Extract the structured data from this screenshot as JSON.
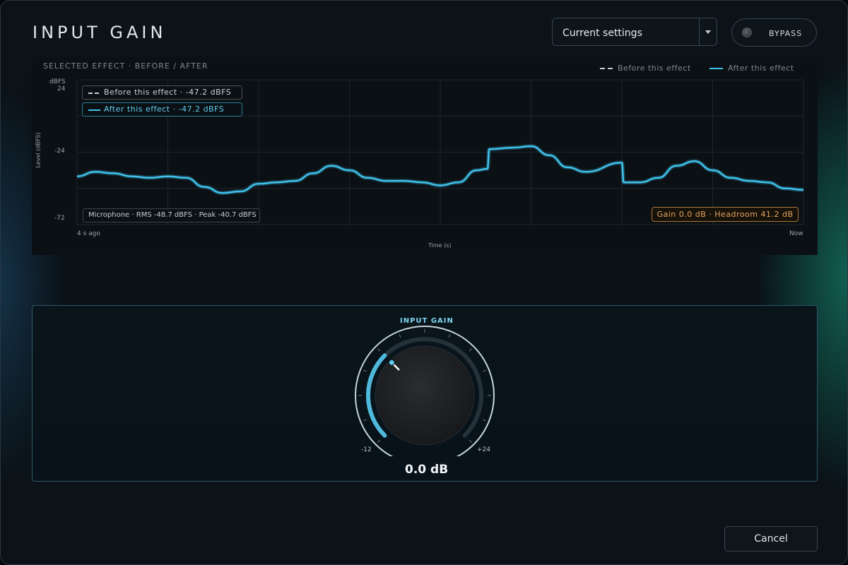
{
  "header": {
    "title": "INPUT GAIN"
  },
  "preset": {
    "selected": "Current settings"
  },
  "bypass": {
    "label": "BYPASS",
    "active": false
  },
  "colors": {
    "before": "#c8cfd4",
    "after": "#3fc3ec",
    "gain_accent": "#e6a65e"
  },
  "chart": {
    "heading": "SELECTED EFFECT · BEFORE / AFTER",
    "legend": {
      "before": "Before this effect",
      "after": "After this effect"
    },
    "callout_before": "Before this effect · -47.2 dBFS",
    "callout_after": "After this effect · -47.2 dBFS",
    "caption": "Microphone · RMS -48.7 dBFS · Peak -40.7 dBFS",
    "gain_readout": "Gain 0.0 dB · Headroom 41.2 dB",
    "unit_label": "dBFS",
    "y_title": "Level (dBFS)",
    "x_title": "Time (s)",
    "x_start_label": "4 s ago",
    "x_end_label": "Now",
    "y_ticks": [
      "24",
      "-24",
      "-72"
    ]
  },
  "chart_data": {
    "type": "line",
    "title": "",
    "xlabel": "Time (s)",
    "ylabel": "Level (dBFS)",
    "ylim": [
      -72,
      24
    ],
    "xlim": [
      -4,
      0
    ],
    "grid": true,
    "legend_position": "top-right",
    "series": [
      {
        "name": "After this effect",
        "x": [
          -4.0,
          -3.9,
          -3.8,
          -3.7,
          -3.6,
          -3.5,
          -3.4,
          -3.3,
          -3.2,
          -3.1,
          -3.0,
          -2.9,
          -2.8,
          -2.7,
          -2.6,
          -2.5,
          -2.4,
          -2.3,
          -2.2,
          -2.1,
          -2.0,
          -1.9,
          -1.8,
          -1.74,
          -1.73,
          -1.6,
          -1.5,
          -1.4,
          -1.3,
          -1.2,
          -1.0,
          -0.99,
          -0.9,
          -0.8,
          -0.7,
          -0.6,
          -0.5,
          -0.4,
          -0.3,
          -0.2,
          -0.1,
          0.0
        ],
        "y": [
          -40,
          -37,
          -38,
          -40,
          -41,
          -40,
          -41,
          -47,
          -51,
          -50,
          -45,
          -44,
          -43,
          -38,
          -33,
          -36,
          -41,
          -43,
          -43,
          -44,
          -46,
          -44,
          -36,
          -35,
          -22,
          -21,
          -20,
          -26,
          -34,
          -37,
          -31,
          -44,
          -44,
          -41,
          -33,
          -30,
          -36,
          -41,
          -43,
          -44,
          -48,
          -49
        ]
      }
    ]
  },
  "knob": {
    "title": "INPUT GAIN",
    "min_label": "-12",
    "max_label": "+24",
    "min": -12,
    "max": 24,
    "value": 0,
    "value_label": "0.0 dB"
  },
  "footer": {
    "cancel_label": "Cancel"
  }
}
